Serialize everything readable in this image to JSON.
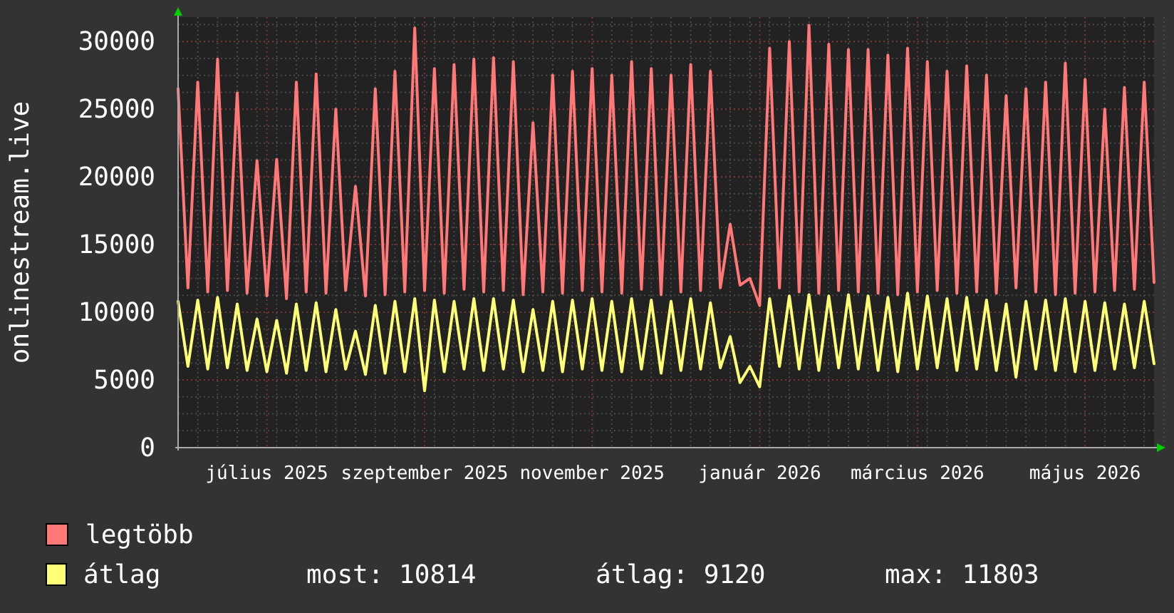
{
  "chart": {
    "chart_data": {
      "type": "line",
      "ylabel": "onlinestream.live",
      "categories": [
        null,
        null,
        null,
        null,
        null,
        null,
        null,
        null,
        null,
        "július 2025",
        null,
        null,
        null,
        null,
        null,
        null,
        null,
        null,
        null,
        null,
        null,
        null,
        null,
        null,
        null,
        "szeptember 2025",
        null,
        null,
        null,
        null,
        null,
        null,
        null,
        null,
        null,
        null,
        null,
        null,
        null,
        null,
        null,
        null,
        "november 2025",
        null,
        null,
        null,
        null,
        null,
        null,
        null,
        null,
        null,
        null,
        null,
        null,
        null,
        null,
        null,
        null,
        "január 2026",
        null,
        null,
        null,
        null,
        null,
        null,
        null,
        null,
        null,
        null,
        null,
        null,
        null,
        null,
        null,
        "március 2026",
        null,
        null,
        null,
        null,
        null,
        null,
        null,
        null,
        null,
        null,
        null,
        null,
        null,
        null,
        null,
        null,
        "május 2026",
        null,
        null,
        null,
        null,
        null,
        null,
        null
      ],
      "ylim": [
        0,
        31800
      ],
      "grid": true,
      "yticks": [
        0,
        5000,
        10000,
        15000,
        20000,
        25000,
        30000
      ],
      "series": [
        {
          "name": "legtöbb",
          "color": "#ff7777",
          "values": [
            26500,
            11800,
            27000,
            11500,
            28700,
            11600,
            26200,
            11400,
            21200,
            11200,
            21300,
            11000,
            27000,
            11500,
            27600,
            11400,
            25000,
            11600,
            19300,
            11200,
            26500,
            11300,
            27800,
            11500,
            31000,
            11600,
            28000,
            11400,
            28300,
            11700,
            28700,
            11500,
            28800,
            11600,
            28500,
            11300,
            24000,
            11500,
            27500,
            11400,
            27800,
            11600,
            28000,
            11500,
            27500,
            11400,
            28500,
            11700,
            28000,
            11300,
            27500,
            11500,
            28300,
            11600,
            27800,
            11800,
            16500,
            12000,
            12500,
            10500,
            29500,
            11800,
            30000,
            11500,
            31200,
            11400,
            29800,
            11600,
            29400,
            11500,
            29400,
            11400,
            29000,
            11300,
            29500,
            11500,
            28500,
            11600,
            27800,
            11400,
            28200,
            11500,
            27500,
            11400,
            26000,
            11800,
            26500,
            11500,
            27000,
            11300,
            28400,
            11400,
            27200,
            11500,
            25000,
            11600,
            26600,
            11700,
            27000,
            12200
          ]
        },
        {
          "name": "átlag",
          "color": "#ffff77",
          "values": [
            10800,
            6000,
            10900,
            5800,
            11100,
            5900,
            10600,
            5700,
            9500,
            5600,
            9400,
            5500,
            10600,
            5700,
            10700,
            5600,
            10200,
            5800,
            8600,
            5400,
            10500,
            5500,
            10800,
            5600,
            11000,
            4200,
            10900,
            5600,
            10800,
            5800,
            11000,
            5700,
            11000,
            5800,
            10900,
            5600,
            10200,
            5700,
            10800,
            5600,
            10900,
            5800,
            11000,
            5700,
            10800,
            5600,
            11000,
            5800,
            10900,
            5500,
            10800,
            5700,
            11000,
            5800,
            10700,
            5900,
            8200,
            4800,
            6000,
            4500,
            11000,
            6000,
            11200,
            5800,
            11300,
            5700,
            11200,
            5900,
            11300,
            5800,
            11200,
            5700,
            11100,
            5600,
            11400,
            5800,
            11200,
            5900,
            11000,
            5700,
            11100,
            5800,
            10900,
            5700,
            10600,
            5200,
            10800,
            5800,
            10900,
            5700,
            11000,
            5600,
            10800,
            5700,
            10700,
            5800,
            10600,
            5900,
            10800,
            6200
          ]
        }
      ]
    }
  },
  "legend_stats": [
    "most: 10814",
    "átlag: 9120",
    "max: 11803"
  ]
}
